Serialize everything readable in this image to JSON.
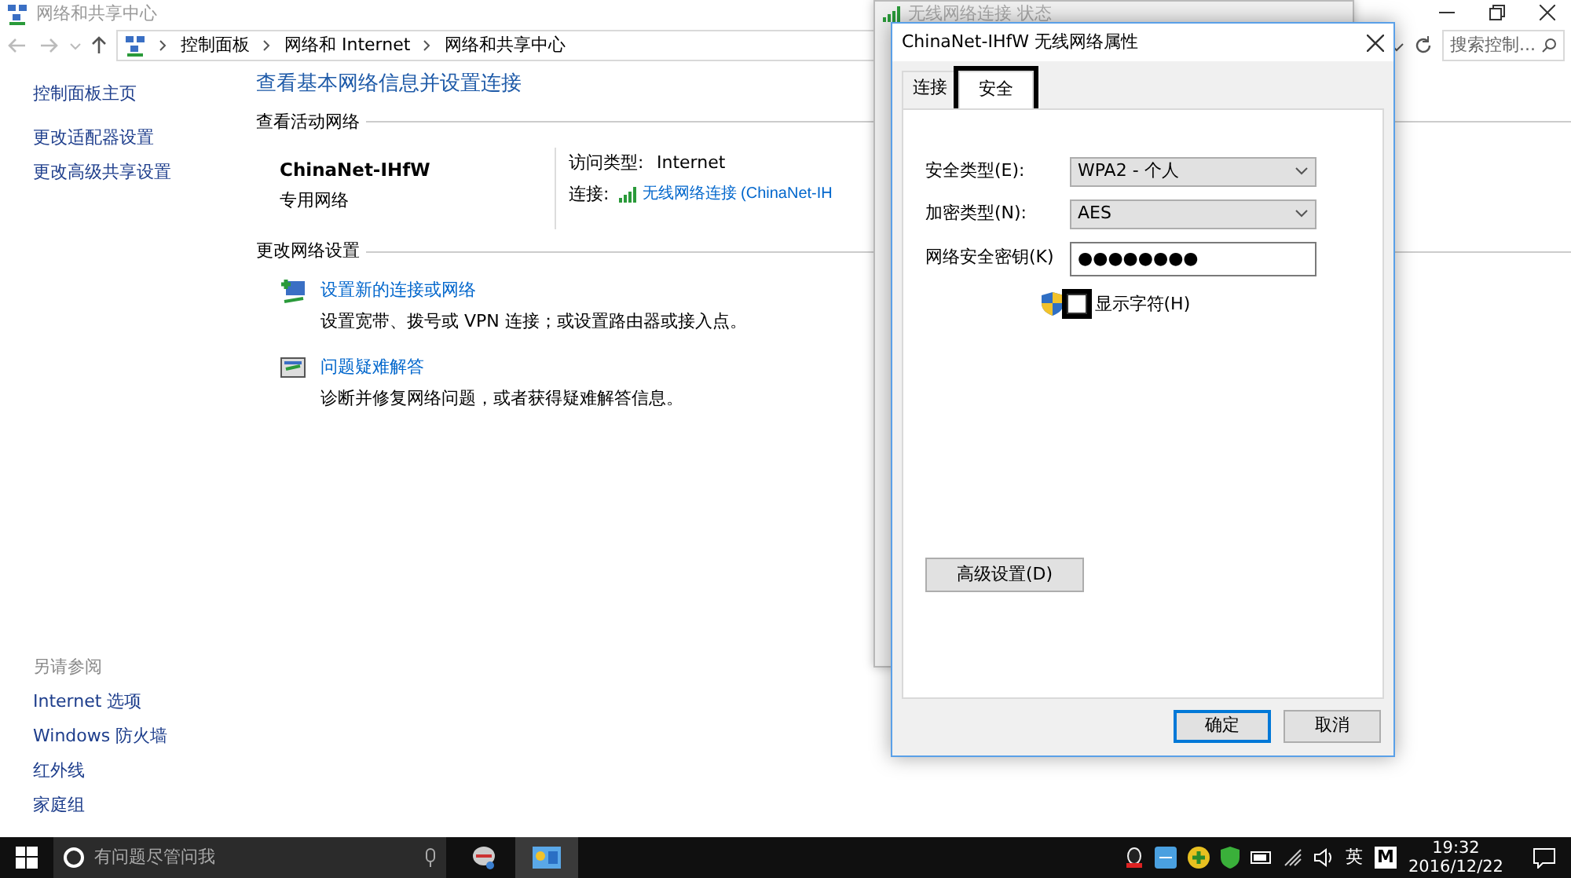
{
  "window": {
    "title": "网络和共享中心"
  },
  "address_bar": {
    "breadcrumb": [
      "控制面板",
      "网络和 Internet",
      "网络和共享中心"
    ]
  },
  "search": {
    "placeholder": "搜索控制..."
  },
  "sidebar": {
    "home": "控制面板主页",
    "links": [
      "更改适配器设置",
      "更改高级共享设置"
    ],
    "see_also": {
      "heading": "另请参阅",
      "links": [
        "Internet 选项",
        "Windows 防火墙",
        "红外线",
        "家庭组"
      ]
    }
  },
  "main": {
    "heading": "查看基本网络信息并设置连接",
    "active_network": {
      "section": "查看活动网络",
      "name": "ChinaNet-IHfW",
      "type": "专用网络",
      "access_label": "访问类型:",
      "access_value": "Internet",
      "connection_label": "连接:",
      "connection_value": "无线网络连接 (ChinaNet-IH"
    },
    "change_settings": {
      "section": "更改网络设置",
      "items": [
        {
          "kind": "setup",
          "title": "设置新的连接或网络",
          "description": "设置宽带、拨号或 VPN 连接；或设置路由器或接入点。"
        },
        {
          "kind": "troubleshoot",
          "title": "问题疑难解答",
          "description": "诊断并修复网络问题，或者获得疑难解答信息。"
        }
      ]
    }
  },
  "background_window": {
    "title": "无线网络连接 状态"
  },
  "dialog": {
    "title": "ChinaNet-IHfW 无线网络属性",
    "tabs": [
      {
        "label": "连接",
        "selected": false,
        "highlighted": false
      },
      {
        "label": "安全",
        "selected": true,
        "highlighted": true
      }
    ],
    "fields": [
      {
        "kind": "select",
        "label": "安全类型(E):",
        "value": "WPA2 - 个人"
      },
      {
        "kind": "select",
        "label": "加密类型(N):",
        "value": "AES"
      },
      {
        "kind": "input",
        "label": "网络安全密钥(K)",
        "value": "●●●●●●●●"
      }
    ],
    "show_characters": {
      "label": "显示字符(H)",
      "checked": false,
      "highlighted": true
    },
    "advanced_button": "高级设置(D)",
    "buttons": [
      {
        "label": "确定",
        "default": true
      },
      {
        "label": "取消",
        "default": false
      }
    ]
  },
  "taskbar": {
    "search_placeholder": "有问题尽管问我",
    "ime": "英",
    "tray_letter": "M",
    "time": "19:32",
    "date": "2016/12/22"
  }
}
